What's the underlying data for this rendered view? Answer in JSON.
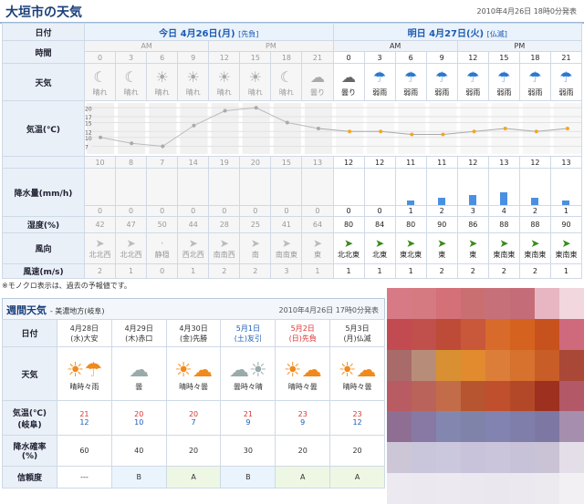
{
  "title": "大垣市の天気",
  "issued": "2010年4月26日 18時0分発表",
  "labels": {
    "date": "日付",
    "time": "時間",
    "weather": "天気",
    "temp": "気温(℃)",
    "precip": "降水量(mm/h)",
    "humidity": "湿度(%)",
    "winddir": "風向",
    "windspeed": "風速(m/s)"
  },
  "today": {
    "title": "今日 4月26日(月)",
    "tag": "[先負]"
  },
  "tomorrow": {
    "title": "明日 4月27日(火)",
    "tag": "[仏滅]"
  },
  "am": "AM",
  "pm": "PM",
  "hours": [
    "0",
    "3",
    "6",
    "9",
    "12",
    "15",
    "18",
    "21",
    "0",
    "3",
    "6",
    "9",
    "12",
    "15",
    "18",
    "21"
  ],
  "weather": [
    "晴れ",
    "晴れ",
    "晴れ",
    "晴れ",
    "晴れ",
    "晴れ",
    "晴れ",
    "曇り",
    "曇り",
    "弱雨",
    "弱雨",
    "弱雨",
    "弱雨",
    "弱雨",
    "弱雨",
    "弱雨"
  ],
  "icons": [
    "moon",
    "moon",
    "sun",
    "sun",
    "sun",
    "sun",
    "moon",
    "cloud",
    "cloud",
    "umbrella",
    "umbrella",
    "umbrella",
    "umbrella",
    "umbrella",
    "umbrella",
    "umbrella"
  ],
  "temps": [
    "10",
    "8",
    "7",
    "14",
    "19",
    "20",
    "15",
    "13",
    "12",
    "12",
    "11",
    "11",
    "12",
    "13",
    "12",
    "13"
  ],
  "temp_axis": [
    "20",
    "17",
    "15",
    "12",
    "10",
    "7"
  ],
  "precip": [
    "0",
    "0",
    "0",
    "0",
    "0",
    "0",
    "0",
    "0",
    "0",
    "0",
    "1",
    "2",
    "3",
    "4",
    "2",
    "1"
  ],
  "humidity": [
    "42",
    "47",
    "50",
    "44",
    "28",
    "25",
    "41",
    "64",
    "80",
    "84",
    "80",
    "90",
    "86",
    "88",
    "88",
    "90"
  ],
  "winddir": [
    "北北西",
    "北北西",
    "静穏",
    "西北西",
    "南南西",
    "南",
    "南南東",
    "東",
    "北北東",
    "北東",
    "東北東",
    "東",
    "東",
    "東南東",
    "東南東",
    "東南東"
  ],
  "windspeed": [
    "2",
    "1",
    "0",
    "1",
    "2",
    "2",
    "3",
    "1",
    "1",
    "1",
    "1",
    "2",
    "2",
    "2",
    "2",
    "1"
  ],
  "note": "※モノクロ表示は、過去の予報値です。",
  "weekly": {
    "title": "週間天気",
    "subtitle": "- 美濃地方(岐阜)",
    "issued": "2010年4月26日 17時0分発表",
    "labels": {
      "date": "日付",
      "weather": "天気",
      "temp": "気温(℃)",
      "temp_sub": "(岐阜)",
      "rain": "降水確率",
      "rain_sub": "(%)",
      "rel": "信頼度"
    },
    "days": [
      {
        "date": "4月28日",
        "dow": "(水)",
        "rokuyo": "大安",
        "wx": "晴時々雨",
        "hi": "21",
        "lo": "12",
        "rain": "60",
        "rel": "---"
      },
      {
        "date": "4月29日",
        "dow": "(木)",
        "rokuyo": "赤口",
        "wx": "曇",
        "hi": "20",
        "lo": "10",
        "rain": "40",
        "rel": "B"
      },
      {
        "date": "4月30日",
        "dow": "(金)",
        "rokuyo": "先勝",
        "wx": "晴時々曇",
        "hi": "20",
        "lo": "7",
        "rain": "20",
        "rel": "A"
      },
      {
        "date": "5月1日",
        "dow": "(土)",
        "rokuyo": "友引",
        "wx": "曇時々晴",
        "hi": "21",
        "lo": "9",
        "rain": "30",
        "rel": "B"
      },
      {
        "date": "5月2日",
        "dow": "(日)",
        "rokuyo": "先負",
        "wx": "晴時々曇",
        "hi": "23",
        "lo": "9",
        "rain": "20",
        "rel": "A"
      },
      {
        "date": "5月3日",
        "dow": "(月)",
        "rokuyo": "仏滅",
        "wx": "晴時々曇",
        "hi": "23",
        "lo": "12",
        "rain": "20",
        "rel": "A"
      }
    ]
  },
  "blur_colors": [
    "#d87a86",
    "#d47a80",
    "#d47077",
    "#c96f72",
    "#c6707a",
    "#c46d79",
    "#e8b6c3",
    "#f2d7de",
    "#c24b52",
    "#c14f4c",
    "#bd4b37",
    "#c9573a",
    "#d86a2c",
    "#d5621f",
    "#c8521e",
    "#cf6a7c",
    "#a96b6a",
    "#b78d79",
    "#d89033",
    "#e28a2e",
    "#dc7e3a",
    "#d6712e",
    "#c95d27",
    "#a94836",
    "#b85b62",
    "#b9635a",
    "#c26c49",
    "#b6552f",
    "#c04f2e",
    "#b34828",
    "#9e3020",
    "#b25867",
    "#8e6f93",
    "#8779a4",
    "#8387b0",
    "#7f83aa",
    "#8283b1",
    "#7f7da9",
    "#7d77a3",
    "#a58eae",
    "#cdc6d7",
    "#c9c6db",
    "#cbc7dc",
    "#c8c3da",
    "#cbc5dc",
    "#c8c2d8",
    "#cac3d6",
    "#e4dee8",
    "#ece9f0",
    "#ebe8ef",
    "#ece9f0",
    "#ebe9ef",
    "#eae7ee",
    "#ebe8ef",
    "#ece9ef",
    "#f3f0f4"
  ]
}
